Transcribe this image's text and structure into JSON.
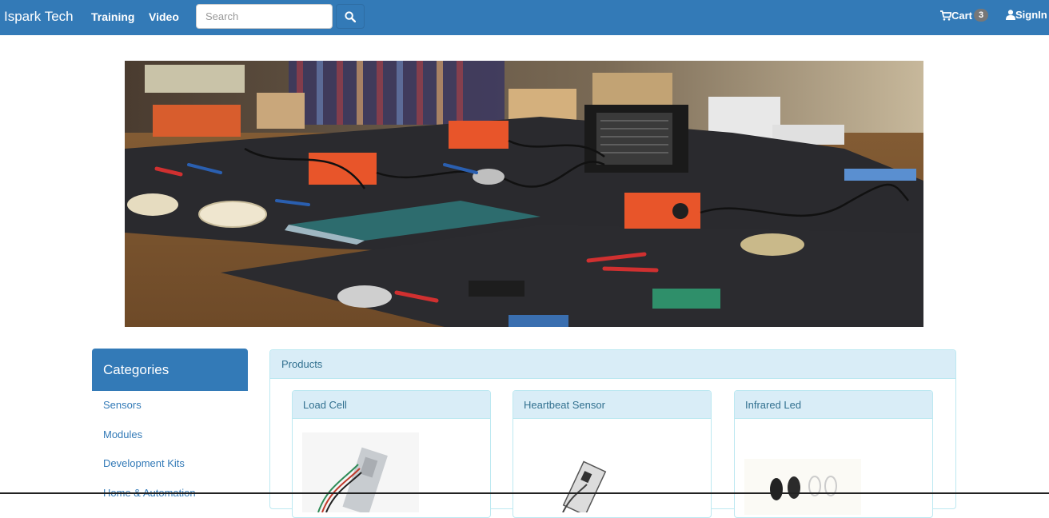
{
  "navbar": {
    "brand": "Ispark Tech",
    "links": {
      "training": "Training",
      "video": "Video"
    },
    "search": {
      "placeholder": "Search",
      "value": ""
    },
    "cart": {
      "label": "Cart",
      "count": "3"
    },
    "signin": {
      "label": "SignIn"
    },
    "colors": {
      "navbar_bg": "#337ab7",
      "text": "#ffffff"
    }
  },
  "hero": {
    "image": "electronics-workbench-photo"
  },
  "categories": {
    "title": "Categories",
    "items": [
      {
        "label": "Sensors"
      },
      {
        "label": "Modules"
      },
      {
        "label": "Development Kits"
      },
      {
        "label": "Home & Automation"
      }
    ]
  },
  "products": {
    "heading": "Products",
    "items": [
      {
        "name": "Load Cell",
        "image": "load-cell-image"
      },
      {
        "name": "Heartbeat Sensor",
        "image": "heartbeat-sensor-image"
      },
      {
        "name": "Infrared Led",
        "image": "infrared-led-image"
      }
    ]
  }
}
